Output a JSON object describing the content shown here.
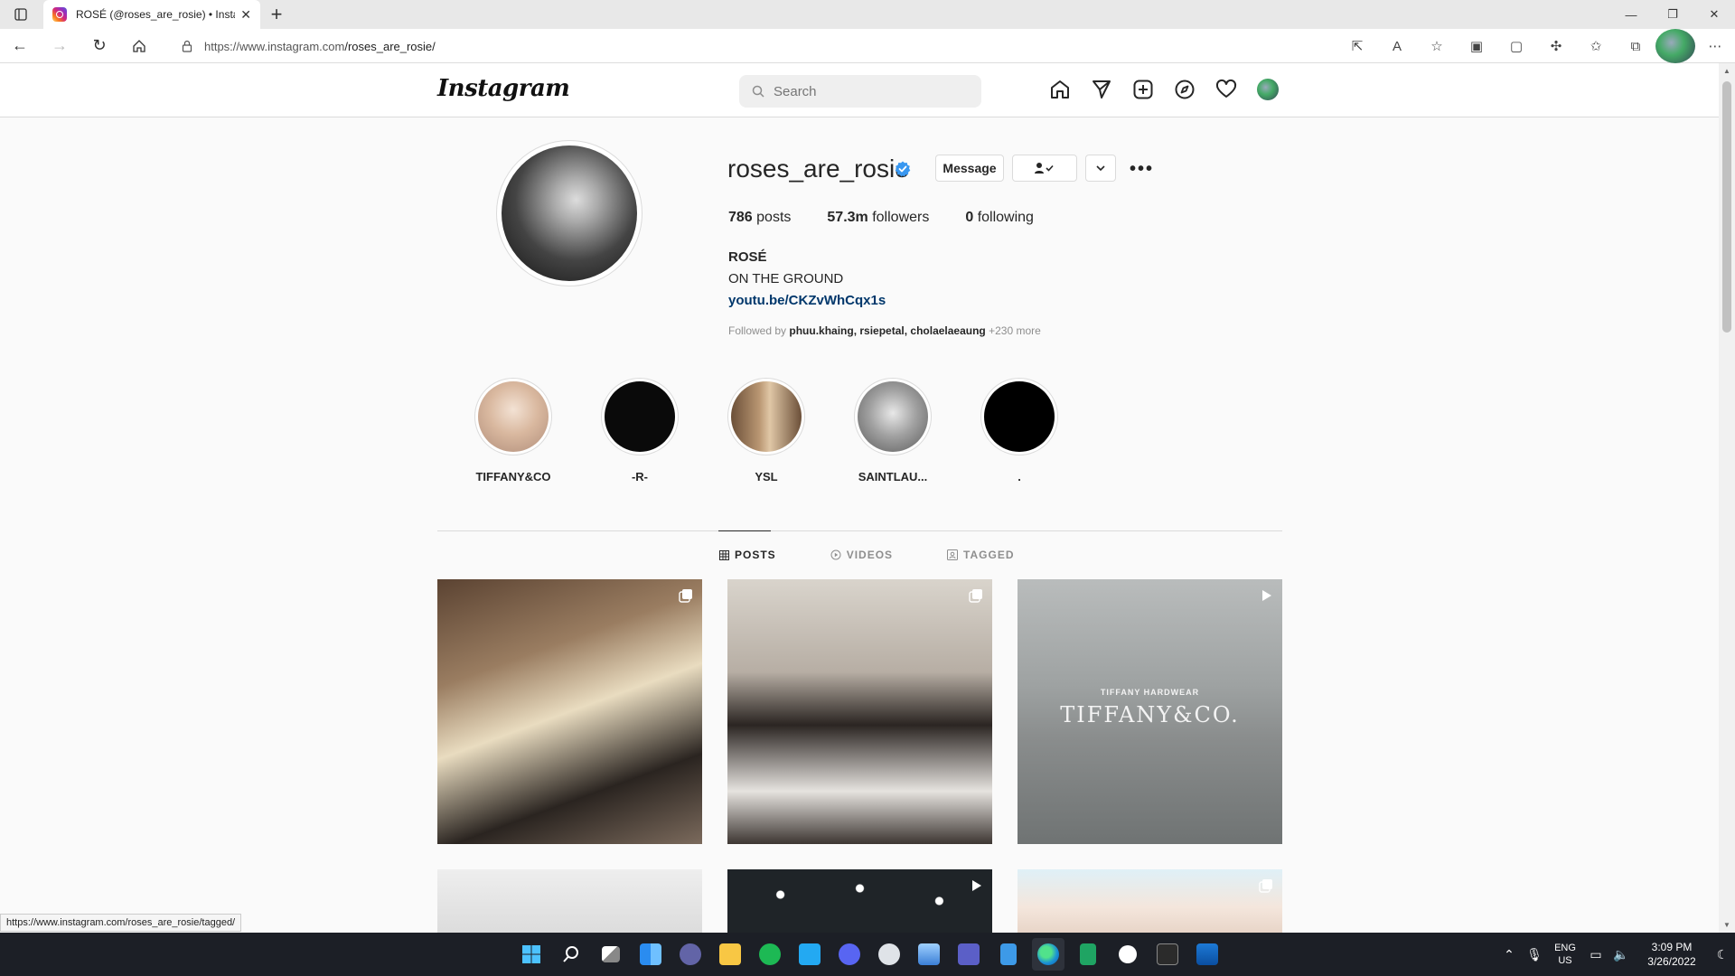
{
  "browser": {
    "tab_title": "ROSÉ (@roses_are_rosie) • Instag",
    "url_prefix": "https://www.instagram.com",
    "url_path": "/roses_are_rosie/",
    "status_url": "https://www.instagram.com/roses_are_rosie/tagged/"
  },
  "header": {
    "logo": "Instagram",
    "search_placeholder": "Search"
  },
  "profile": {
    "username": "roses_are_rosie",
    "message_label": "Message",
    "stats": {
      "posts_count": "786",
      "posts_label": " posts",
      "followers_count": "57.3m",
      "followers_label": " followers",
      "following_count": "0",
      "following_label": " following"
    },
    "bio_name": "ROSÉ",
    "bio_line": "ON THE GROUND",
    "bio_link": "youtu.be/CKZvWhCqx1s",
    "followed_by_prefix": "Followed by ",
    "followed_by_names": "phuu.khaing, rsiepetal, cholaelaeaung",
    "followed_by_more": " +230 more"
  },
  "highlights": [
    {
      "label": "TIFFANY&CO",
      "color": "#e8d8cc"
    },
    {
      "label": "-R-",
      "color": "#0a0a0a"
    },
    {
      "label": "YSL",
      "color": "#8b6a4a"
    },
    {
      "label": "SAINTLAU...",
      "color": "#9a9a9a"
    },
    {
      "label": ".",
      "color": "#000000"
    }
  ],
  "tabs": [
    {
      "label": "POSTS",
      "active": true
    },
    {
      "label": "VIDEOS",
      "active": false
    },
    {
      "label": "TAGGED",
      "active": false
    }
  ],
  "posts": [
    {
      "overlay_small": "",
      "overlay_big": ""
    },
    {
      "overlay_small": "",
      "overlay_big": ""
    },
    {
      "overlay_small": "TIFFANY HARDWEAR",
      "overlay_big": "TIFFANY&CO."
    }
  ],
  "taskbar": {
    "lang_top": "ENG",
    "lang_bottom": "US",
    "time": "3:09 PM",
    "date": "3/26/2022"
  }
}
